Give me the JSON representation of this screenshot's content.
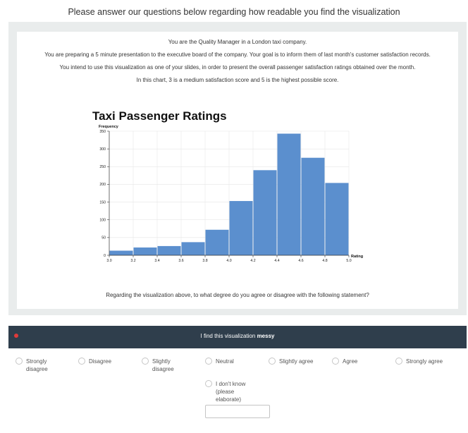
{
  "page_heading": "Please answer our questions below regarding how readable you find the visualization",
  "intro": [
    "You are the Quality Manager in a London taxi company.",
    "You are preparing a 5 minute presentation to the executive board of the company. Your goal is to inform them of last month's customer satisfaction records.",
    "You intend to use this visualization as one of your slides, in order to present the overall passenger satisfaction ratings obtained over the month.",
    "In this chart, 3 is a medium satisfaction score and 5 is the highest possible score."
  ],
  "chart_data": {
    "type": "bar",
    "title": "Taxi Passenger Ratings",
    "ylabel": "Frequency",
    "xlabel": "Rating",
    "bin_edges": [
      3.0,
      3.2,
      3.4,
      3.6,
      3.8,
      4.0,
      4.2,
      4.4,
      4.6,
      4.8,
      5.0
    ],
    "values": [
      13,
      22,
      26,
      37,
      72,
      153,
      240,
      343,
      275,
      204
    ],
    "x_ticks": [
      "3.0",
      "3.2",
      "3.4",
      "3.6",
      "3.8",
      "4.0",
      "4.2",
      "4.4",
      "4.6",
      "4.8",
      "5.0"
    ],
    "y_ticks": [
      "0",
      "50",
      "100",
      "150",
      "200",
      "250",
      "300",
      "350"
    ],
    "ylim": [
      0,
      350
    ],
    "xlim": [
      3.0,
      5.0
    ],
    "grid": true,
    "bar_color": "#5b8fce"
  },
  "question": "Regarding the visualization above, to what degree do you agree or disagree with the following statement?",
  "statement": {
    "prefix": "I find this visualization ",
    "emphasis": "messy"
  },
  "options": [
    {
      "label": "Strongly disagree",
      "lines": [
        "Strongly",
        "disagree"
      ]
    },
    {
      "label": "Disagree",
      "lines": [
        "Disagree"
      ]
    },
    {
      "label": "Slightly disagree",
      "lines": [
        "Slightly",
        "disagree"
      ]
    },
    {
      "label": "Neutral",
      "lines": [
        "Neutral"
      ]
    },
    {
      "label": "Slightly agree",
      "lines": [
        "Slightly agree"
      ]
    },
    {
      "label": "Agree",
      "lines": [
        "Agree"
      ]
    },
    {
      "label": "Strongly agree",
      "lines": [
        "Strongly agree"
      ]
    },
    {
      "label": "I don't know (please elaborate)",
      "lines": [
        "I don't know",
        "(please",
        "elaborate)"
      ]
    }
  ],
  "colors": {
    "statement_bar": "#2f3e4c",
    "required": "#e03a3a",
    "panel": "#e9ecec"
  }
}
